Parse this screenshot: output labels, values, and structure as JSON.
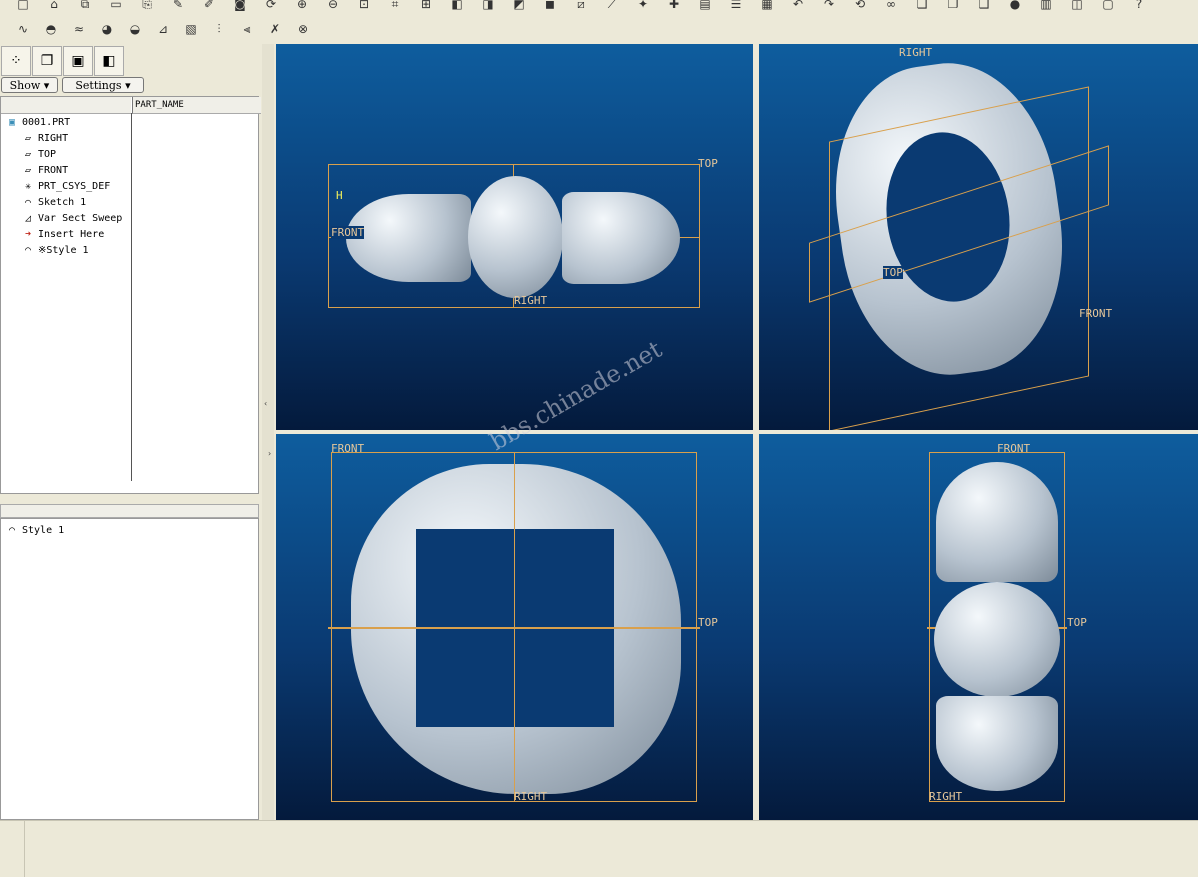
{
  "toolbar": {
    "row1_icons": [
      "new-icon",
      "open-icon",
      "open-recent-icon",
      "save-icon",
      "save-copy-icon",
      "edit-icon",
      "pencil-icon",
      "camera-icon",
      "redraw-icon",
      "zoom-in-icon",
      "zoom-out-icon",
      "refit-icon",
      "sketch-icon",
      "datum-icon",
      "view-front-icon",
      "view-side-icon",
      "view-top-icon",
      "view-shaded-icon",
      "plane-display-icon",
      "axis-display-icon",
      "point-display-icon",
      "csys-display-icon",
      "analysis-icon",
      "layers-icon",
      "color-icon",
      "undo-icon",
      "redo-icon",
      "regenerate-icon",
      "link-icon",
      "copy-icon",
      "paste-icon",
      "paste-special-icon",
      "status-icon",
      "grid-icon",
      "window-icon",
      "single-view-icon",
      "help-icon"
    ],
    "row2_icons": [
      "curve-style-icon",
      "surface-style-icon",
      "wave-icon",
      "color-wheel-icon",
      "reflection-icon",
      "draft-icon",
      "analysis-map-icon",
      "porcupine-icon",
      "delete-porcupine-icon",
      "delete-curve-icon",
      "delete-surface-icon"
    ]
  },
  "left_panel": {
    "tabs": [
      "model-tree-tab",
      "folder-browser-tab",
      "favorites-tab",
      "layers-tab"
    ],
    "show_label": "Show",
    "settings_label": "Settings",
    "column_header": "PART_NAME",
    "tree": [
      {
        "icon": "part-icon",
        "label": "0001.PRT"
      },
      {
        "icon": "datum-plane-icon",
        "label": "RIGHT"
      },
      {
        "icon": "datum-plane-icon",
        "label": "TOP"
      },
      {
        "icon": "datum-plane-icon",
        "label": "FRONT"
      },
      {
        "icon": "csys-icon",
        "label": "PRT_CSYS_DEF"
      },
      {
        "icon": "sketch-icon",
        "label": "Sketch 1"
      },
      {
        "icon": "var-sect-sweep-icon",
        "label": "Var Sect Sweep"
      },
      {
        "icon": "insert-here-arrow-icon",
        "label": "Insert Here"
      },
      {
        "icon": "style-icon",
        "label": "※Style 1"
      }
    ],
    "lower_item": "Style 1"
  },
  "viewports": {
    "top_left": {
      "label_top": "TOP",
      "label_front": "FRONT",
      "label_right": "RIGHT",
      "label_axis": "H"
    },
    "top_right": {
      "label_right": "RIGHT",
      "label_top": "TOP",
      "label_front": "FRONT"
    },
    "bottom_left": {
      "label_front": "FRONT",
      "label_top": "TOP",
      "label_right": "RIGHT"
    },
    "bottom_right": {
      "label_front": "FRONT",
      "label_top": "TOP",
      "label_right": "RIGHT"
    }
  },
  "watermark": "bbs.chinade.net",
  "colors": {
    "viewport_top": "#0e5d9e",
    "viewport_bottom": "#041a3c",
    "datum": "#d9a04c",
    "surface": "#b7c3cf"
  }
}
